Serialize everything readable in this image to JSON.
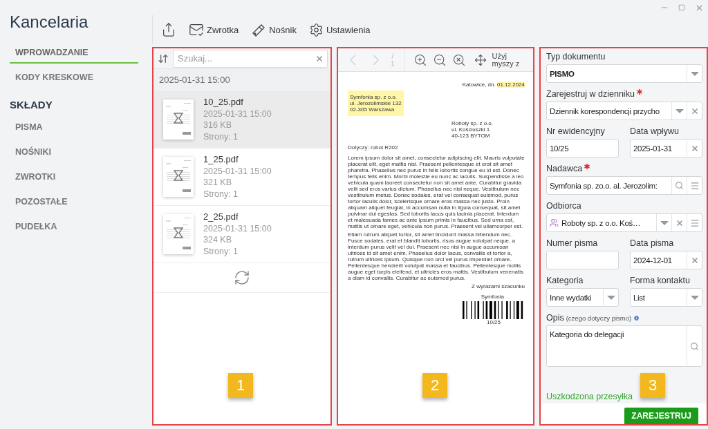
{
  "app_title": "Kancelaria",
  "nav": [
    {
      "label": "WPROWADZANIE",
      "kind": "item",
      "selected": true
    },
    {
      "label": "KODY KRESKOWE",
      "kind": "item",
      "selected": false
    },
    {
      "label": "SKŁADY",
      "kind": "header"
    },
    {
      "label": "PISMA",
      "kind": "item",
      "selected": false
    },
    {
      "label": "NOŚNIKI",
      "kind": "item",
      "selected": false
    },
    {
      "label": "ZWROTKI",
      "kind": "item",
      "selected": false
    },
    {
      "label": "POZOSTAŁE",
      "kind": "item",
      "selected": false
    },
    {
      "label": "PUDEŁKA",
      "kind": "item",
      "selected": false
    }
  ],
  "toolbar": [
    {
      "kind": "export"
    },
    {
      "kind": "return_receipt",
      "label": "Zwrotka"
    },
    {
      "kind": "media",
      "label": "Nośnik"
    },
    {
      "kind": "settings",
      "label": "Ustawienia"
    }
  ],
  "files_panel": {
    "badge": "1",
    "search_placeholder": "Szukaj...",
    "group": "2025-01-31 15:00",
    "files": [
      {
        "name": "10_25.pdf",
        "date": "2025-01-31 15:00",
        "size": "316 KB",
        "pages": "Strony: 1",
        "selected": true
      },
      {
        "name": "1_25.pdf",
        "date": "2025-01-31 15:00",
        "size": "321 KB",
        "pages": "Strony: 1",
        "selected": false
      },
      {
        "name": "2_25.pdf",
        "date": "2025-01-31 15:00",
        "size": "324 KB",
        "pages": "Strony: 1",
        "selected": false
      }
    ]
  },
  "viewer": {
    "badge": "2",
    "page_separator": "/",
    "page": "1",
    "mouse_label": "Użyj myszy z",
    "document": {
      "place": "Katowice, dn.",
      "date": "01.12.2024",
      "sender": [
        "Symfonia sp. z o.o.",
        "ul. Jerozolimskie 132",
        "02-305 Warszawa"
      ],
      "recipient": [
        "Roboty sp. z o.o.",
        "ul. Kościuszki 1",
        "40-123 BYTOM"
      ],
      "subject": "Dotyczy: robot R202",
      "paragraphs": [
        "Lorem ipsum dolor sit amet, consectetur adipiscing elit. Mauris vulputate placerat elit, eget mattis nisl. Praesent pellentesque et erat sit amet pharetra. Phasellus nec purus in felis lobortis congue eu id est. Donec tempus felis enim. Morbi molestie eu nunc ac iaculis. Suspendisse a leo vehicula quam laoreet consectetur non sit amet ante. Curabitur gravida velit sed eros varius dictum. Phasellus nec nisl neque. Vestibulum nec vestibulum metus. Donec sodales, erat vel consequat euismod, purus tortor iaculis dolor, scelerisque ornare eros massa nec justo. Proin aliquam aliquet feugiat, in accumsan nulla in ligula consequat, sit amet pulvinar dui egestas. Sed lobortis lacus quis lacinia placerat. Interdum et malesuada fames ac ante ipsum primis in faucibus. Sed urna est, mattis ut ornare eget, vehicula non purus. Praesent vel ullamcorper est.",
        "Etiam rutrum aliquet tortor, sit amet tincidunt massa bibendum nec. Fusce sodales, erat et blandit lobortis, risus augue volutpat neque, a interdum purus velit vel dui. Praesent nec nisi in augue accumsan ultrices id sit amet enim. Phasellus dolor lacus, convallis et tortor a, rutrum ultrices ipsum. Quisque non orci vel purus imperdiet ornare. Pellentesque hendrerit volutpat massa et faucibus. Pellentesque mollis augue eget turpis eleifend, et ultricies eros mattis. Vestibulum venenatis a diam id convallis. Curabitur ac euismod purus."
      ],
      "closing": "Z wyrazami szacunku",
      "signature": "Symfonia",
      "barcode_text": "10/25"
    }
  },
  "form": {
    "badge": "3",
    "rows": [
      [
        {
          "label": "Typ dokumentu",
          "kind": "select",
          "value": "PISMO",
          "bold": true,
          "buttons": [
            {
              "kind": "dropdown"
            }
          ]
        }
      ],
      [
        {
          "label": "Zarejestruj w dzienniku",
          "required": true,
          "kind": "select",
          "value": "Dziennik korespondencji przycho",
          "buttons": [
            {
              "kind": "dropdown"
            },
            {
              "kind": "clear"
            }
          ]
        }
      ],
      [
        {
          "label": "Nr ewidencyjny",
          "kind": "input",
          "value": "10/25"
        },
        {
          "label": "Data wpływu",
          "kind": "input",
          "value": "2025-01-31",
          "buttons": [
            {
              "kind": "clear"
            }
          ]
        }
      ],
      [
        {
          "label": "Nadawca",
          "required": true,
          "kind": "input",
          "value": "Symfonia sp. zo.o. al. Jerozolim:",
          "buttons": [
            {
              "kind": "search"
            },
            {
              "kind": "menu"
            }
          ]
        }
      ],
      [
        {
          "label": "Odbiorca",
          "kind": "contact_select",
          "value": "Roboty sp. z o.o. Koś…",
          "buttons": [
            {
              "kind": "dropdown"
            },
            {
              "kind": "clear"
            },
            {
              "kind": "menu"
            }
          ]
        }
      ],
      [
        {
          "label": "Numer pisma",
          "kind": "input"
        },
        {
          "label": "Data pisma",
          "kind": "input",
          "value": "2024-12-01",
          "buttons": [
            {
              "kind": "clear"
            }
          ]
        }
      ],
      [
        {
          "label": "Kategoria",
          "kind": "select",
          "value": "Inne wydatki",
          "buttons": [
            {
              "kind": "dropdown"
            }
          ]
        },
        {
          "label": "Forma kontaktu",
          "kind": "select",
          "value": "List",
          "buttons": [
            {
              "kind": "dropdown"
            }
          ]
        }
      ],
      [
        {
          "label": "Opis",
          "hint": "(czego dotyczy pismo)",
          "info": true,
          "kind": "textarea",
          "value": "Kategoria do delegacji",
          "buttons": [
            {
              "kind": "search"
            }
          ]
        }
      ]
    ],
    "damaged_link": "Uszkodzona przesyłka",
    "submit": "ZAREJESTRUJ"
  }
}
